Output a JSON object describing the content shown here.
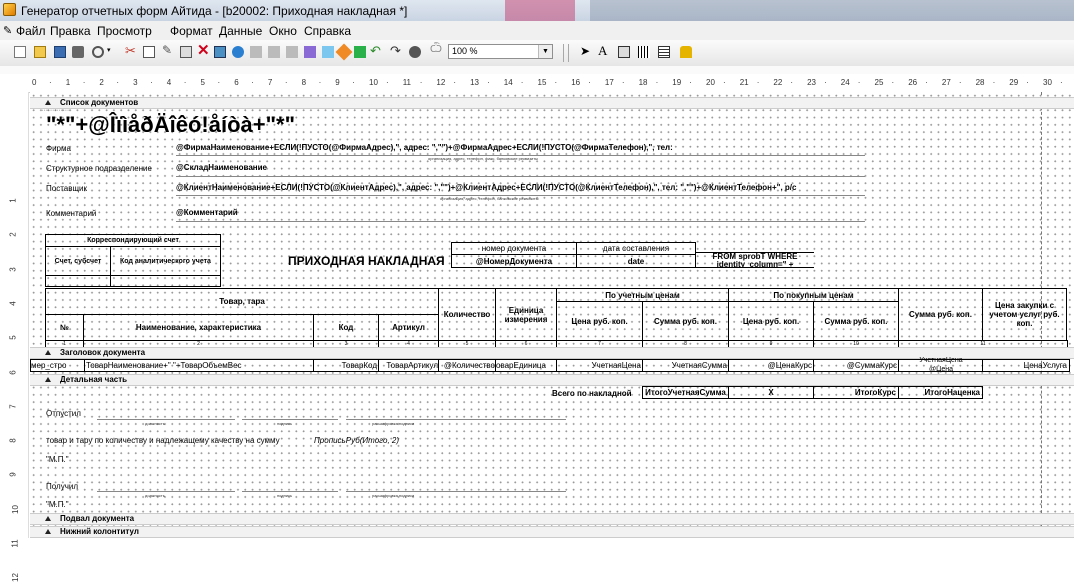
{
  "window": {
    "title": "Генератор отчетных форм Айтида - [b20002: Приходная накладная *]"
  },
  "menu": [
    "Файл",
    "Правка",
    "Просмотр",
    "Формат",
    "Данные",
    "Окно",
    "Справка"
  ],
  "toolbar": {
    "zoom": "100 %"
  },
  "ruler": {
    "h": [
      "0",
      "1",
      "2",
      "3",
      "4",
      "5",
      "6",
      "7",
      "8",
      "9",
      "10",
      "11",
      "12",
      "13",
      "14",
      "15",
      "16",
      "17",
      "18",
      "19",
      "20",
      "21",
      "22",
      "23",
      "24",
      "25",
      "26",
      "27",
      "28",
      "29",
      "30"
    ],
    "v": [
      "1",
      "2",
      "3",
      "4",
      "5",
      "6",
      "7",
      "8",
      "9",
      "10",
      "11",
      "12"
    ]
  },
  "bands": {
    "doc_list": "Список документов",
    "doc_header": "Заголовок документа",
    "detail": "Детальная часть",
    "doc_footer": "Подвал документа",
    "page_footer": "Нижний колонтитул"
  },
  "header": {
    "garbled": "\"*\"+@ÎïìåðÄîêó!åíòà+\"*\"",
    "firm_label": "Фирма",
    "firm_value": "@ФирмаНаименование+ЕСЛИ(!ПУСТО(@ФирмаАдрес),\", адрес: \",\"\")+@ФирмаАдрес+ЕСЛИ(!ПУСТО(@ФирмаТелефон),\", тел:",
    "firm_hint": "организация, адрес, телефон, факс, банковские реквизиты",
    "division_label": "Структурное подразделение",
    "division_value": "@СкладНаименование",
    "supplier_label": "Поставщик",
    "supplier_value": "@КлиентНаименование+ЕСЛИ(!ПУСТО(@КлиентАдрес),\", адрес: \",\"\")+@КлиентАдрес+ЕСЛИ(!ПУСТО(@КлиентТелефон),\", тел: \",\"\")+@КлиентТелефон+\", р/с",
    "supplier_hint": "организация, адрес, телефон, банковские реквизиты",
    "comment_label": "Комментарий",
    "comment_value": "@Комментарий"
  },
  "account_box": {
    "title": "Корреспондирующий счет",
    "col1": "Счет, субсчет",
    "col2": "Код аналитического учета"
  },
  "doc_title": "ПРИХОДНАЯ НАКЛАДНАЯ",
  "doc_meta": {
    "num_label": "номер документа",
    "date_label": "дата составления",
    "num_value": "@НомерДокумента",
    "date_value": "date",
    "sql_text": "FROM sprobT WHERE identity_column=\" +"
  },
  "table": {
    "goods": "Товар, тара",
    "no": "№",
    "name": "Наименование, характеристика",
    "code": "Код",
    "article": "Артикул",
    "qty": "Количество",
    "unit": "Единица измерения",
    "by_accounting": "По учетным ценам",
    "by_purchase": "По покупным ценам",
    "price": "Цена руб. коп.",
    "sum": "Сумма руб. коп.",
    "total_sum": "Сумма руб. коп.",
    "purchase_price": "Цена закупки с учетом услуг руб. коп.",
    "col_numbers": [
      "1",
      "2",
      "3",
      "4",
      "5",
      "6",
      "7",
      "8",
      "9",
      "10",
      "11"
    ]
  },
  "detail_row": {
    "num": "мер_стро",
    "name": "ТоварНаименование+\" \"+ТоварОбъемВес",
    "code": "ТоварКод",
    "article": "ТоварАртикул",
    "qty": "@Количество",
    "unit": "оварЕдиница",
    "price": "УчетнаяЦена",
    "sum": "УчетнаяСумма",
    "pprice": "@ЦенаКурс",
    "psum": "@СуммаКурс",
    "total": "УчетнаяЦена",
    "total2": "@Цена",
    "last": "ЦенаУслуга"
  },
  "totals": {
    "label": "Всего по накладной",
    "acc_sum": "ИтогоУчетнаяСумма",
    "x": "X",
    "purchase": "ИтогоКурс",
    "markup": "ИтогоНаценка"
  },
  "footer": {
    "released": "Отпустил",
    "position": "должность",
    "signature": "подпись",
    "decoding": "расшифровка подписи",
    "goods_text": "товар и тару по количеству и надлежащему качеству на сумму",
    "amount_words": "ПрописьРуб(Итого, 2)",
    "mp": "\"М.П.\"",
    "received": "Получил"
  }
}
